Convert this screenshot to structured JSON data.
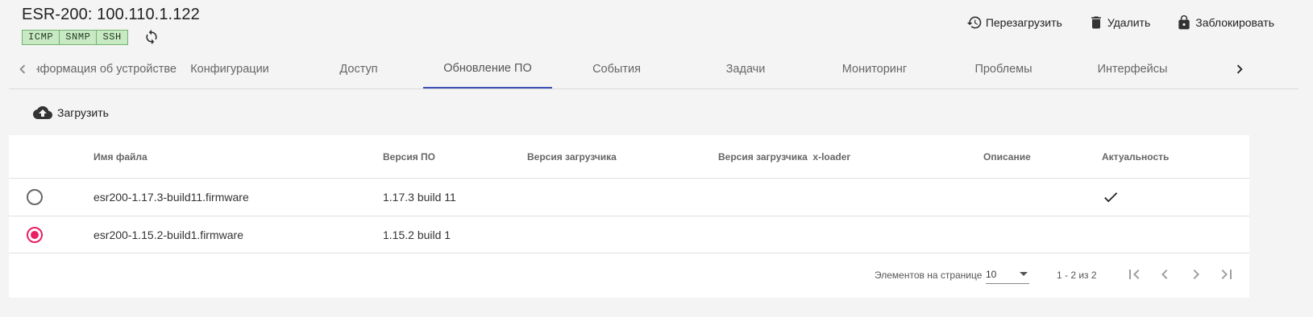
{
  "device": {
    "title": "ESR-200: 100.110.1.122",
    "protocols": [
      "ICMP",
      "SNMP",
      "SSH"
    ]
  },
  "actions": {
    "reboot": "Перезагрузить",
    "delete": "Удалить",
    "lock": "Заблокировать"
  },
  "tabs": [
    {
      "label": "Информация об устройстве",
      "active": false
    },
    {
      "label": "Конфигурации",
      "active": false
    },
    {
      "label": "Доступ",
      "active": false
    },
    {
      "label": "Обновление ПО",
      "active": true
    },
    {
      "label": "События",
      "active": false
    },
    {
      "label": "Задачи",
      "active": false
    },
    {
      "label": "Мониторинг",
      "active": false
    },
    {
      "label": "Проблемы",
      "active": false
    },
    {
      "label": "Интерфейсы",
      "active": false
    }
  ],
  "toolbar": {
    "upload": "Загрузить"
  },
  "table": {
    "columns": {
      "file": "Имя файла",
      "version": "Версия ПО",
      "bootloader": "Версия загрузчика",
      "xloader": "Версия загрузчика  x-loader",
      "description": "Описание",
      "actual": "Актуальность"
    },
    "rows": [
      {
        "file": "esr200-1.17.3-build11.firmware",
        "version": "1.17.3 build 11",
        "bootloader": "",
        "xloader": "",
        "description": "",
        "actual": true,
        "selected": false
      },
      {
        "file": "esr200-1.15.2-build1.firmware",
        "version": "1.15.2 build 1",
        "bootloader": "",
        "xloader": "",
        "description": "",
        "actual": false,
        "selected": true
      }
    ]
  },
  "paginator": {
    "items_per_page_label": "Элементов на странице",
    "items_per_page": "10",
    "range": "1 - 2 из 2"
  },
  "colors": {
    "accent": "#3f51b5",
    "radio_selected": "#e91e63",
    "badge_bg": "#c8e9c4",
    "badge_border": "#6fb36f"
  }
}
